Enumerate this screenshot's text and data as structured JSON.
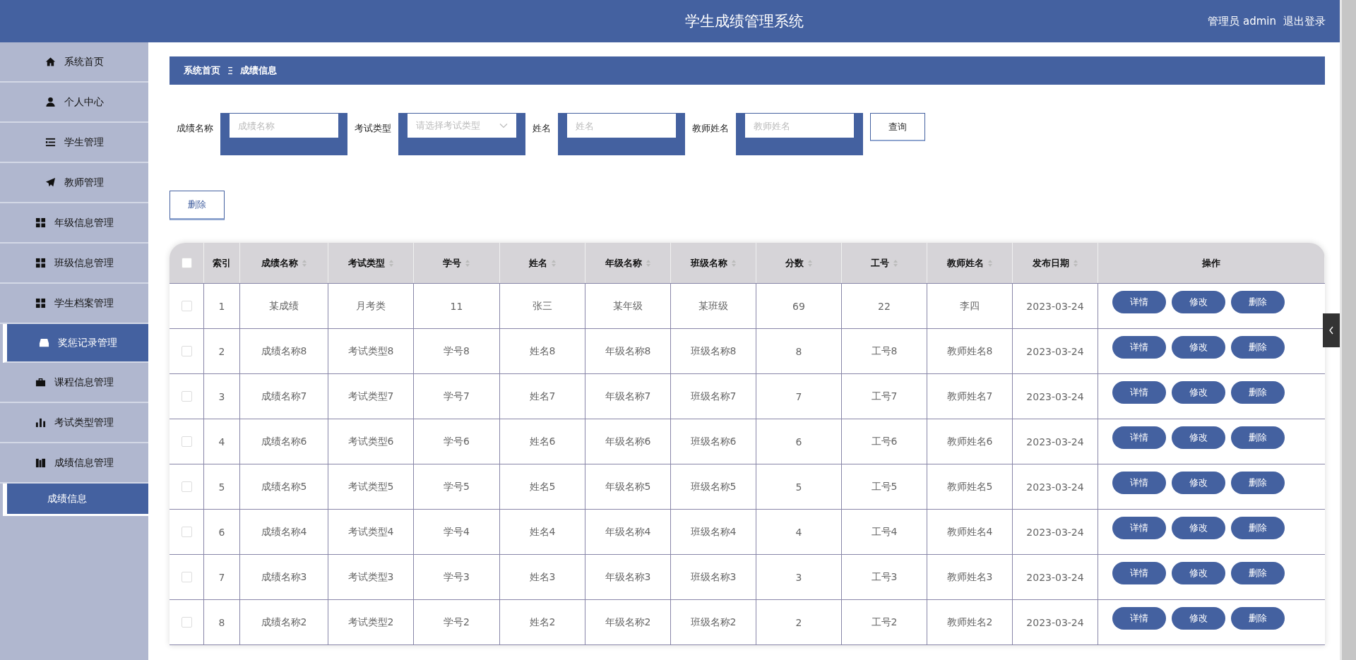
{
  "header": {
    "title": "学生成绩管理系统",
    "user": "管理员 admin",
    "logout": "退出登录"
  },
  "sidebar": {
    "items": [
      {
        "label": "系统首页",
        "highlighted": false
      },
      {
        "label": "个人中心",
        "highlighted": false
      },
      {
        "label": "学生管理",
        "highlighted": false
      },
      {
        "label": "教师管理",
        "highlighted": false
      },
      {
        "label": "年级信息管理",
        "highlighted": false
      },
      {
        "label": "班级信息管理",
        "highlighted": false
      },
      {
        "label": "学生档案管理",
        "highlighted": false
      },
      {
        "label": "奖惩记录管理",
        "highlighted": true
      },
      {
        "label": "课程信息管理",
        "highlighted": false
      },
      {
        "label": "考试类型管理",
        "highlighted": false
      },
      {
        "label": "成绩信息管理",
        "highlighted": false,
        "expanded": true,
        "children": [
          {
            "label": "成绩信息",
            "selected": true
          }
        ]
      }
    ]
  },
  "breadcrumb": [
    "系统首页",
    "成绩信息"
  ],
  "search": {
    "fields": [
      {
        "kind": "input",
        "label": "成绩名称",
        "placeholder": "成绩名称"
      },
      {
        "kind": "select",
        "label": "考试类型",
        "placeholder": "请选择考试类型"
      },
      {
        "kind": "input",
        "label": "姓名",
        "placeholder": "姓名"
      },
      {
        "kind": "input",
        "label": "教师姓名",
        "placeholder": "教师姓名"
      }
    ],
    "button": "查询"
  },
  "delete_button": "删除",
  "table": {
    "all_checked": false,
    "columns": [
      {
        "label": "索引",
        "sortable": false
      },
      {
        "label": "成绩名称",
        "sortable": true
      },
      {
        "label": "考试类型",
        "sortable": true
      },
      {
        "label": "学号",
        "sortable": true
      },
      {
        "label": "姓名",
        "sortable": true
      },
      {
        "label": "年级名称",
        "sortable": true
      },
      {
        "label": "班级名称",
        "sortable": true
      },
      {
        "label": "分数",
        "sortable": true
      },
      {
        "label": "工号",
        "sortable": true
      },
      {
        "label": "教师姓名",
        "sortable": true
      },
      {
        "label": "发布日期",
        "sortable": true
      },
      {
        "label": "操作",
        "sortable": false
      }
    ],
    "rows": [
      {
        "checked": false,
        "cells": [
          "1",
          "某成绩",
          "月考类",
          "11",
          "张三",
          "某年级",
          "某班级",
          "69",
          "22",
          "李四",
          "2023-03-24"
        ],
        "actions": [
          "详情",
          "修改",
          "删除"
        ]
      },
      {
        "checked": false,
        "cells": [
          "2",
          "成绩名称8",
          "考试类型8",
          "学号8",
          "姓名8",
          "年级名称8",
          "班级名称8",
          "8",
          "工号8",
          "教师姓名8",
          "2023-03-24"
        ],
        "actions": [
          "详情",
          "修改",
          "删除"
        ]
      },
      {
        "checked": false,
        "cells": [
          "3",
          "成绩名称7",
          "考试类型7",
          "学号7",
          "姓名7",
          "年级名称7",
          "班级名称7",
          "7",
          "工号7",
          "教师姓名7",
          "2023-03-24"
        ],
        "actions": [
          "详情",
          "修改",
          "删除"
        ]
      },
      {
        "checked": false,
        "cells": [
          "4",
          "成绩名称6",
          "考试类型6",
          "学号6",
          "姓名6",
          "年级名称6",
          "班级名称6",
          "6",
          "工号6",
          "教师姓名6",
          "2023-03-24"
        ],
        "actions": [
          "详情",
          "修改",
          "删除"
        ]
      },
      {
        "checked": false,
        "cells": [
          "5",
          "成绩名称5",
          "考试类型5",
          "学号5",
          "姓名5",
          "年级名称5",
          "班级名称5",
          "5",
          "工号5",
          "教师姓名5",
          "2023-03-24"
        ],
        "actions": [
          "详情",
          "修改",
          "删除"
        ]
      },
      {
        "checked": false,
        "cells": [
          "6",
          "成绩名称4",
          "考试类型4",
          "学号4",
          "姓名4",
          "年级名称4",
          "班级名称4",
          "4",
          "工号4",
          "教师姓名4",
          "2023-03-24"
        ],
        "actions": [
          "详情",
          "修改",
          "删除"
        ]
      },
      {
        "checked": false,
        "cells": [
          "7",
          "成绩名称3",
          "考试类型3",
          "学号3",
          "姓名3",
          "年级名称3",
          "班级名称3",
          "3",
          "工号3",
          "教师姓名3",
          "2023-03-24"
        ],
        "actions": [
          "详情",
          "修改",
          "删除"
        ]
      },
      {
        "checked": false,
        "cells": [
          "8",
          "成绩名称2",
          "考试类型2",
          "学号2",
          "姓名2",
          "年级名称2",
          "班级名称2",
          "2",
          "工号2",
          "教师姓名2",
          "2023-03-24"
        ],
        "actions": [
          "详情",
          "修改",
          "删除"
        ]
      }
    ]
  }
}
